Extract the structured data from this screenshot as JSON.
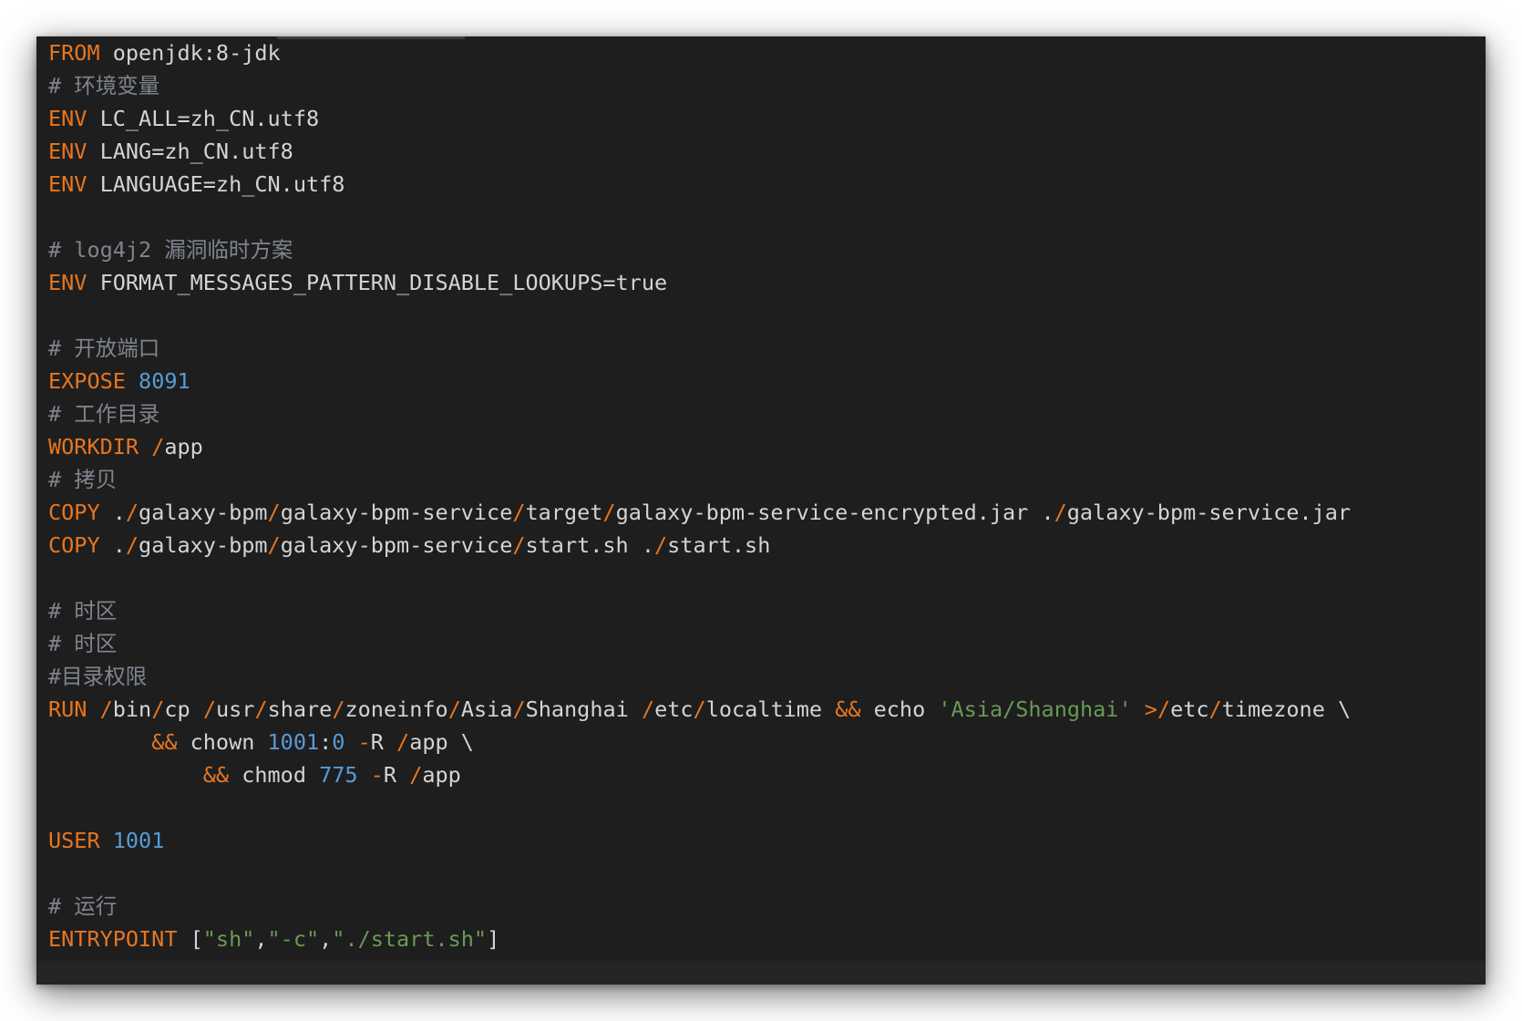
{
  "lines": [
    [
      {
        "k": "kw",
        "t": "FROM"
      },
      {
        "k": "txt",
        "t": " openjdk:8-jdk"
      }
    ],
    [
      {
        "k": "cm",
        "t": "# 环境变量"
      }
    ],
    [
      {
        "k": "kw",
        "t": "ENV"
      },
      {
        "k": "txt",
        "t": " LC_ALL=zh_CN.utf8"
      }
    ],
    [
      {
        "k": "kw",
        "t": "ENV"
      },
      {
        "k": "txt",
        "t": " LANG=zh_CN.utf8"
      }
    ],
    [
      {
        "k": "kw",
        "t": "ENV"
      },
      {
        "k": "txt",
        "t": " LANGUAGE=zh_CN.utf8"
      }
    ],
    [],
    [
      {
        "k": "cm",
        "t": "# log4j2 漏洞临时方案"
      }
    ],
    [
      {
        "k": "kw",
        "t": "ENV"
      },
      {
        "k": "txt",
        "t": " FORMAT_MESSAGES_PATTERN_DISABLE_LOOKUPS=true"
      }
    ],
    [],
    [
      {
        "k": "cm",
        "t": "# 开放端口"
      }
    ],
    [
      {
        "k": "kw",
        "t": "EXPOSE"
      },
      {
        "k": "txt",
        "t": " "
      },
      {
        "k": "num",
        "t": "8091"
      }
    ],
    [
      {
        "k": "cm",
        "t": "# 工作目录"
      }
    ],
    [
      {
        "k": "kw",
        "t": "WORKDIR"
      },
      {
        "k": "txt",
        "t": " "
      },
      {
        "k": "op",
        "t": "/"
      },
      {
        "k": "txt",
        "t": "app"
      }
    ],
    [
      {
        "k": "cm",
        "t": "# 拷贝"
      }
    ],
    [
      {
        "k": "kw",
        "t": "COPY"
      },
      {
        "k": "txt",
        "t": " ."
      },
      {
        "k": "op",
        "t": "/"
      },
      {
        "k": "txt",
        "t": "galaxy-bpm"
      },
      {
        "k": "op",
        "t": "/"
      },
      {
        "k": "txt",
        "t": "galaxy-bpm-service"
      },
      {
        "k": "op",
        "t": "/"
      },
      {
        "k": "txt",
        "t": "target"
      },
      {
        "k": "op",
        "t": "/"
      },
      {
        "k": "txt",
        "t": "galaxy-bpm-service-encrypted.jar ."
      },
      {
        "k": "op",
        "t": "/"
      },
      {
        "k": "txt",
        "t": "galaxy-bpm-service.jar"
      }
    ],
    [
      {
        "k": "kw",
        "t": "COPY"
      },
      {
        "k": "txt",
        "t": " ."
      },
      {
        "k": "op",
        "t": "/"
      },
      {
        "k": "txt",
        "t": "galaxy-bpm"
      },
      {
        "k": "op",
        "t": "/"
      },
      {
        "k": "txt",
        "t": "galaxy-bpm-service"
      },
      {
        "k": "op",
        "t": "/"
      },
      {
        "k": "txt",
        "t": "start.sh ."
      },
      {
        "k": "op",
        "t": "/"
      },
      {
        "k": "txt",
        "t": "start.sh"
      }
    ],
    [],
    [
      {
        "k": "cm",
        "t": "# 时区"
      }
    ],
    [
      {
        "k": "cm",
        "t": "# 时区"
      }
    ],
    [
      {
        "k": "cm",
        "t": "#目录权限"
      }
    ],
    [
      {
        "k": "kw",
        "t": "RUN"
      },
      {
        "k": "txt",
        "t": " "
      },
      {
        "k": "op",
        "t": "/"
      },
      {
        "k": "txt",
        "t": "bin"
      },
      {
        "k": "op",
        "t": "/"
      },
      {
        "k": "txt",
        "t": "cp "
      },
      {
        "k": "op",
        "t": "/"
      },
      {
        "k": "txt",
        "t": "usr"
      },
      {
        "k": "op",
        "t": "/"
      },
      {
        "k": "txt",
        "t": "share"
      },
      {
        "k": "op",
        "t": "/"
      },
      {
        "k": "txt",
        "t": "zoneinfo"
      },
      {
        "k": "op",
        "t": "/"
      },
      {
        "k": "txt",
        "t": "Asia"
      },
      {
        "k": "op",
        "t": "/"
      },
      {
        "k": "txt",
        "t": "Shanghai "
      },
      {
        "k": "op",
        "t": "/"
      },
      {
        "k": "txt",
        "t": "etc"
      },
      {
        "k": "op",
        "t": "/"
      },
      {
        "k": "txt",
        "t": "localtime "
      },
      {
        "k": "op",
        "t": "&&"
      },
      {
        "k": "txt",
        "t": " echo "
      },
      {
        "k": "str",
        "t": "'Asia/Shanghai'"
      },
      {
        "k": "txt",
        "t": " "
      },
      {
        "k": "op",
        "t": ">/"
      },
      {
        "k": "txt",
        "t": "etc"
      },
      {
        "k": "op",
        "t": "/"
      },
      {
        "k": "txt",
        "t": "timezone \\"
      }
    ],
    [
      {
        "k": "txt",
        "t": "        "
      },
      {
        "k": "op",
        "t": "&&"
      },
      {
        "k": "txt",
        "t": " chown "
      },
      {
        "k": "num",
        "t": "1001"
      },
      {
        "k": "txt",
        "t": ":"
      },
      {
        "k": "num",
        "t": "0"
      },
      {
        "k": "txt",
        "t": " "
      },
      {
        "k": "op",
        "t": "-"
      },
      {
        "k": "txt",
        "t": "R "
      },
      {
        "k": "op",
        "t": "/"
      },
      {
        "k": "txt",
        "t": "app \\"
      }
    ],
    [
      {
        "k": "txt",
        "t": "            "
      },
      {
        "k": "op",
        "t": "&&"
      },
      {
        "k": "txt",
        "t": " chmod "
      },
      {
        "k": "num",
        "t": "775"
      },
      {
        "k": "txt",
        "t": " "
      },
      {
        "k": "op",
        "t": "-"
      },
      {
        "k": "txt",
        "t": "R "
      },
      {
        "k": "op",
        "t": "/"
      },
      {
        "k": "txt",
        "t": "app"
      }
    ],
    [],
    [
      {
        "k": "kw",
        "t": "USER"
      },
      {
        "k": "txt",
        "t": " "
      },
      {
        "k": "num",
        "t": "1001"
      }
    ],
    [],
    [
      {
        "k": "cm",
        "t": "# 运行"
      }
    ],
    [
      {
        "k": "kw",
        "t": "ENTRYPOINT"
      },
      {
        "k": "txt",
        "t": " ["
      },
      {
        "k": "str",
        "t": "\"sh\""
      },
      {
        "k": "txt",
        "t": ","
      },
      {
        "k": "str",
        "t": "\"-c\""
      },
      {
        "k": "txt",
        "t": ","
      },
      {
        "k": "str",
        "t": "\"./start.sh\""
      },
      {
        "k": "txt",
        "t": "]"
      }
    ]
  ]
}
